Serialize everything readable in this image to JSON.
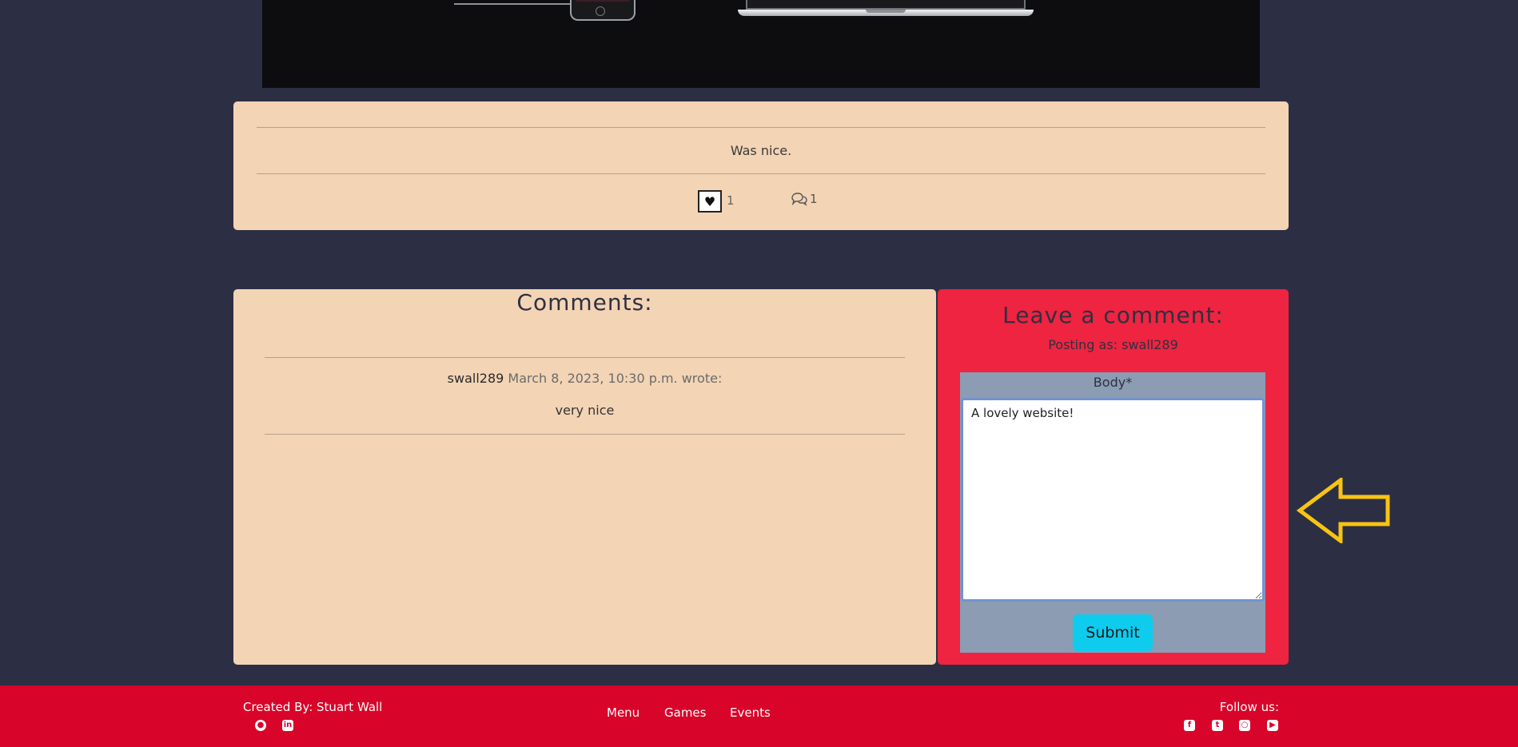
{
  "post": {
    "content": "Was nice.",
    "like_count": "1",
    "comment_count": "1"
  },
  "comments": {
    "title": "Comments:",
    "items": [
      {
        "author": "swall289",
        "date": "March 8, 2023, 10:30 p.m.",
        "wrote": "wrote:",
        "body": "very nice"
      }
    ]
  },
  "leave_comment": {
    "title": "Leave a comment:",
    "posting_as": "Posting as: swall289",
    "body_label": "Body*",
    "body_value": "A lovely website!",
    "submit_label": "Submit"
  },
  "footer": {
    "created_by": "Created By: Stuart Wall",
    "nav": [
      "Menu",
      "Games",
      "Events"
    ],
    "follow_us": "Follow us:",
    "creator_icons": [
      "github-icon",
      "linkedin-icon"
    ],
    "social_icons": [
      "facebook-icon",
      "twitter-icon",
      "instagram-icon",
      "youtube-icon"
    ]
  },
  "colors": {
    "background": "#2c2e44",
    "card": "#f3d4b5",
    "accent_red": "#ee2440",
    "footer_red": "#d90429",
    "submit_cyan": "#0fcbee",
    "form_grey": "#8c9cb3",
    "arrow_yellow": "#f7c412"
  }
}
